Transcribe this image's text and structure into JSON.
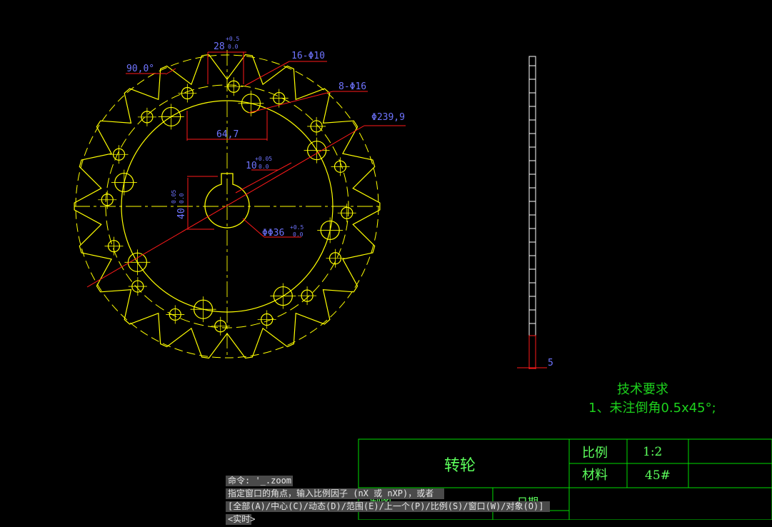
{
  "drawing": {
    "dim_chord": "28",
    "dim_chord_tol_up": "+0.5",
    "dim_chord_tol_low": "0.0",
    "dim_angle": "90,0°",
    "dim_small_holes": "16-Φ10",
    "dim_large_holes": "8-Φ16",
    "dim_outer_dia": "Φ239,9",
    "dim_hole_span": "64,7",
    "dim_keyway": "10",
    "dim_keyway_tol_up": "+0.05",
    "dim_keyway_tol_low": "0.0",
    "dim_keyway_depth": "40",
    "dim_keyway_depth_tol_up": "0.05",
    "dim_keyway_depth_tol_low": "0.0",
    "dim_bore": "ΦΦ36",
    "dim_bore_tol_up": "+0.5",
    "dim_bore_tol_low": "0.0",
    "dim_thickness": "5"
  },
  "tech_req": {
    "title": "技术要求",
    "item1": "1、未注倒角0.5x45°;"
  },
  "title_block": {
    "part_name": "转轮",
    "scale_label": "比例",
    "scale_value": "1:2",
    "material_label": "材料",
    "material_value": "45#",
    "drawn_label": "制图",
    "date_label": "日期"
  },
  "command": {
    "line1": "命令: '_.zoom",
    "line2": "指定窗口的角点，输入比例因子 (nX 或 nXP)，或者",
    "line3": "[全部(A)/中心(C)/动态(D)/范围(E)/上一个(P)/比例(S)/窗口(W)/对象(O)]",
    "line4": "<实时>"
  },
  "colors": {
    "background": "#000000",
    "geometry": "#ffff00",
    "dimension_text": "#6f74ff",
    "leaders": "#ff1a1a",
    "title_block": "#00ff00",
    "outline": "#ffffff"
  }
}
